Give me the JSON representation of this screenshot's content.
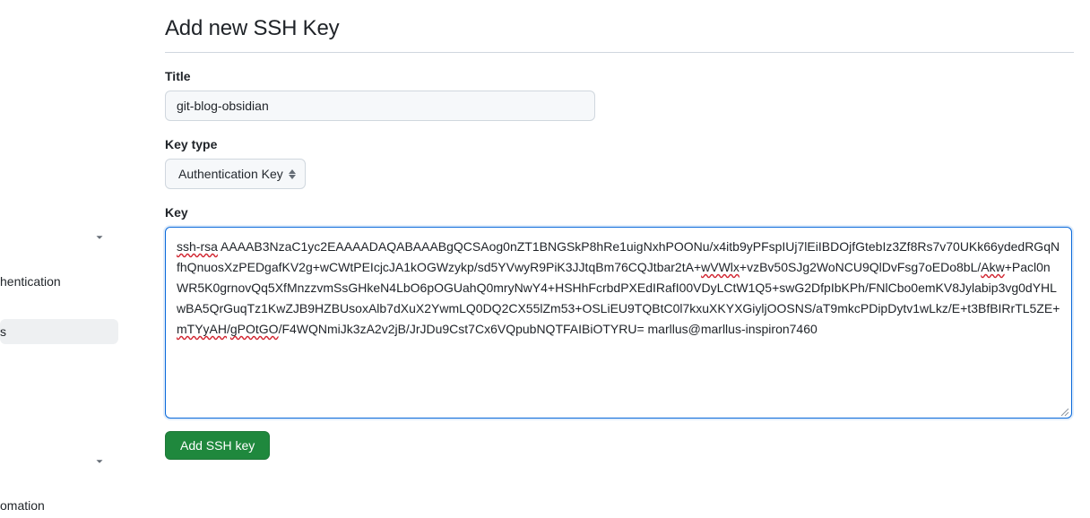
{
  "page": {
    "title": "Add new SSH Key"
  },
  "form": {
    "title_label": "Title",
    "title_value": "git-blog-obsidian",
    "keytype_label": "Key type",
    "keytype_value": "Authentication Key",
    "key_label": "Key",
    "key_value_segments": [
      {
        "t": "ssh-rsa",
        "spell": true
      },
      {
        "t": " AAAAB3NzaC1yc2EAAAADAQABAAABgQCSAog0nZT1BNGSkP8hRe1uigNxhPOONu/x4itb9yPFspIUj7lEiIBDOjfGtebIz3Zf8Rs7v70UKk66ydedRGqNfhQnuosXzPEDgafKV2g+wCWtPEIcjcJA1kOGWzykp/sd5YVwyR9PiK3JJtqBm76CQJtbar2tA+",
        "spell": false
      },
      {
        "t": "wVWlx",
        "spell": true
      },
      {
        "t": "+vzBv50SJg2WoNCU9QlDvFsg7oEDo8bL/",
        "spell": false
      },
      {
        "t": "Akw",
        "spell": true
      },
      {
        "t": "+Pacl0nWR5K0grnovQq5XfMnzzvmSsGHkeN4LbO6pOGUahQ0mryNwY4+HSHhFcrbdPXEdIRafI00VDyLCtW1Q5+swG2DfpIbKPh/FNlCbo0emKV8Jylabip3vg0dYHLwBA5QrGuqTz1KwZJB9HZBUsoxAlb7dXuX2YwmLQ0DQ2CX55lZm53+OSLiEU9TQBtC0l7kxuXKYXGiyljOOSNS/aT9mkcPDipDytv1wLkz/E+t3BfBIRrTL5ZE+",
        "spell": false
      },
      {
        "t": "mTYyAH",
        "spell": true
      },
      {
        "t": "/",
        "spell": false
      },
      {
        "t": "gPOtGO",
        "spell": true
      },
      {
        "t": "/F4WQNmiJk3zA2v2jB/JrJDu9Cst7Cx6VQpubNQTFAIBiOTYRU= marllus@marllus-inspiron7460",
        "spell": false
      }
    ],
    "submit_label": "Add SSH key"
  },
  "sidebar": {
    "section1_items": [
      {
        "label": "hentication"
      },
      {
        "label": "s",
        "active": true
      }
    ],
    "section2_items": [
      {
        "label": "omation"
      }
    ]
  }
}
